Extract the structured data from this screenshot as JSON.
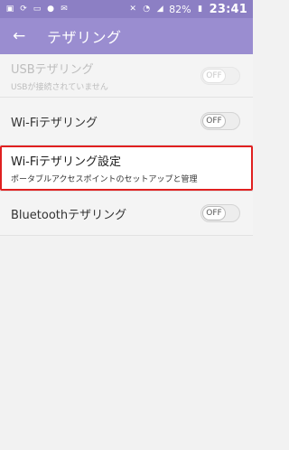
{
  "status_bar": {
    "battery": "82%",
    "time": "23:41"
  },
  "app_bar": {
    "title": "テザリング"
  },
  "settings": {
    "usb": {
      "title": "USBテザリング",
      "subtitle": "USBが接続されていません",
      "toggle": "OFF"
    },
    "wifi": {
      "title": "Wi-Fiテザリング",
      "toggle": "OFF"
    },
    "wifi_settings": {
      "title": "Wi-Fiテザリング設定",
      "subtitle": "ポータブルアクセスポイントのセットアップと管理"
    },
    "bluetooth": {
      "title": "Bluetoothテザリング",
      "toggle": "OFF"
    }
  }
}
